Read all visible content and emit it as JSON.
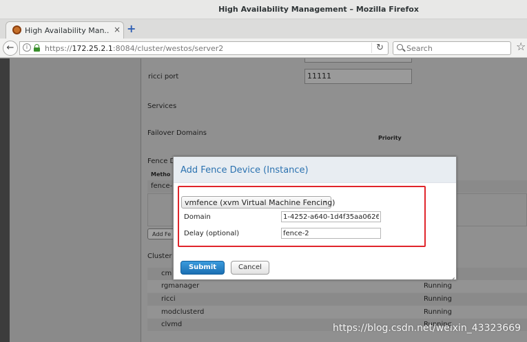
{
  "window": {
    "title": "High Availability Management – Mozilla Firefox"
  },
  "tab": {
    "label": "High Availability Man...",
    "close": "×",
    "new_tab": "+"
  },
  "navbar": {
    "url_scheme": "https://",
    "url_host": "172.25.2.1",
    "url_path": ":8084/cluster/westos/server2",
    "search_placeholder": "Search"
  },
  "page": {
    "ricci_port_label": "ricci port",
    "ricci_port_value": "11111",
    "services_label": "Services",
    "failover_label": "Failover Domains",
    "priority_header": "Priority",
    "fence_label": "Fence D",
    "method_header": "Metho",
    "fence_item": "fence-",
    "add_fence_button": "Add Fe",
    "cluster_label": "Cluster",
    "services": [
      {
        "name": "cm",
        "status": ""
      },
      {
        "name": "rgmanager",
        "status": "Running"
      },
      {
        "name": "ricci",
        "status": "Running"
      },
      {
        "name": "modclusterd",
        "status": "Running"
      },
      {
        "name": "clvmd",
        "status": "Running"
      }
    ]
  },
  "modal": {
    "title": "Add Fence Device (Instance)",
    "agent_selected": "vmfence (xvm Virtual Machine Fencing)",
    "domain_label": "Domain",
    "domain_value": "1-4252-a640-1d4f35aa0626",
    "delay_label": "Delay (optional)",
    "delay_value": "fence-2",
    "submit_label": "Submit",
    "cancel_label": "Cancel"
  },
  "watermark": "https://blog.csdn.net/weixin_43323669",
  "colors": {
    "accent": "#2b72b0",
    "highlight": "#e0242a",
    "submit": "#1b6fb3"
  }
}
